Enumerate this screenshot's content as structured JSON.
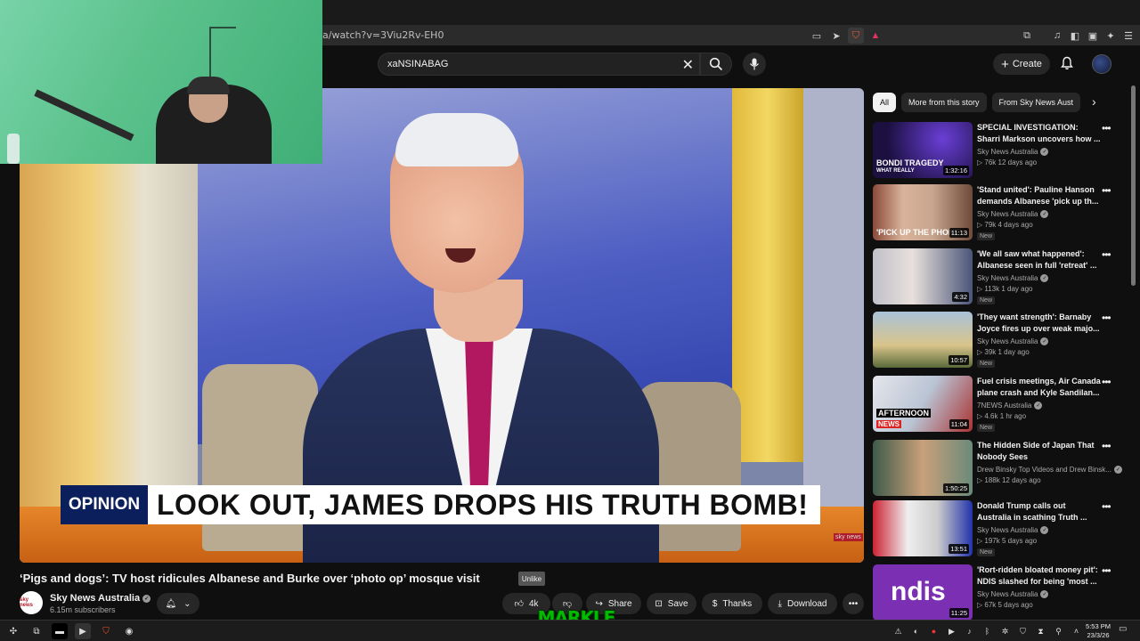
{
  "browser": {
    "url": "a/watch?v=3Viu2Rv-EH0"
  },
  "header": {
    "search_value": "xaNSINABAG",
    "create_label": "Create"
  },
  "video": {
    "opinion_label": "OPINION",
    "headline": "LOOK OUT, JAMES DROPS HIS TRUTH BOMB!",
    "title": "‘Pigs and dogs’: TV host ridicules Albanese and Burke over ‘photo op’ mosque visit"
  },
  "channel": {
    "name": "Sky News Australia",
    "subscribers": "6.15m subscribers",
    "avatar_text": "sky news"
  },
  "actions": {
    "like_count": "4k",
    "share_label": "Share",
    "save_label": "Save",
    "thanks_label": "Thanks",
    "download_label": "Download",
    "tooltip": "Unlike"
  },
  "overlay_logo_text": "MARKLE",
  "sidebar": {
    "chips": [
      "All",
      "More from this story",
      "From Sky News Aust"
    ],
    "items": [
      {
        "title": "SPECIAL INVESTIGATION: Sharri Markson uncovers how ...",
        "channel": "Sky News Australia",
        "meta": "▷ 76k   12 days ago",
        "badge": "",
        "duration": "1:32:16",
        "thumb_text": "BONDI TRAGEDY",
        "thumb_sub": "WHAT REALLY"
      },
      {
        "title": "'Stand united': Pauline Hanson demands Albanese 'pick up th...",
        "channel": "Sky News Australia",
        "meta": "▷ 79k   4 days ago",
        "badge": "New",
        "duration": "11:13",
        "thumb_text": "'PICK UP THE PHONE'",
        "thumb_sub": ""
      },
      {
        "title": "'We all saw what happened': Albanese seen in full 'retreat' ...",
        "channel": "Sky News Australia",
        "meta": "▷ 113k   1 day ago",
        "badge": "New",
        "duration": "4:32",
        "thumb_text": "",
        "thumb_sub": ""
      },
      {
        "title": "'They want strength': Barnaby Joyce fires up over weak majo...",
        "channel": "Sky News Australia",
        "meta": "▷ 39k   1 day ago",
        "badge": "New",
        "duration": "10:57",
        "thumb_text": "",
        "thumb_sub": ""
      },
      {
        "title": "Fuel crisis meetings, Air Canada plane crash and Kyle Sandilan...",
        "channel": "7NEWS Australia",
        "meta": "▷ 4.6k   1 hr ago",
        "badge": "New",
        "duration": "11:04",
        "thumb_text": "AFTERNOON",
        "thumb_sub": "NEWS"
      },
      {
        "title": "The Hidden Side of Japan That Nobody Sees",
        "channel": "Drew Binsky Top Videos and Drew Binsk...",
        "meta": "▷ 188k   12 days ago",
        "badge": "",
        "duration": "1:50:25",
        "thumb_text": "",
        "thumb_sub": ""
      },
      {
        "title": "Donald Trump calls out Australia in scathing Truth ...",
        "channel": "Sky News Australia",
        "meta": "▷ 197k   5 days ago",
        "badge": "New",
        "duration": "13:51",
        "thumb_text": "",
        "thumb_sub": ""
      },
      {
        "title": "'Rort-ridden bloated money pit': NDIS slashed for being 'most ...",
        "channel": "Sky News Australia",
        "meta": "▷ 67k   5 days ago",
        "badge": "",
        "duration": "11:25",
        "thumb_text": "ndis",
        "thumb_sub": ""
      }
    ]
  },
  "taskbar": {
    "time": "5:53 PM",
    "date": "23/3/26"
  }
}
